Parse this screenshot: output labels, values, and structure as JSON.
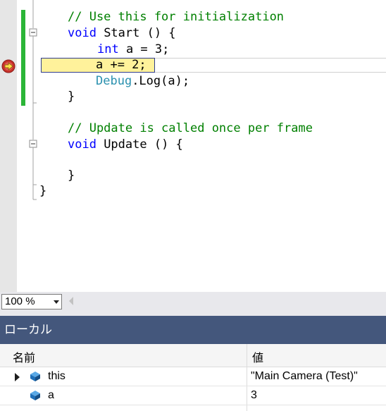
{
  "editor": {
    "lines": [
      {
        "id": "l1",
        "text": "// Use this for initialization"
      },
      {
        "id": "l2a",
        "text": "void"
      },
      {
        "id": "l2b",
        "text": " Start () {"
      },
      {
        "id": "l3a",
        "text": "int"
      },
      {
        "id": "l3b",
        "text": " a = 3;"
      },
      {
        "id": "l4",
        "text": "a += 2;"
      },
      {
        "id": "l5a",
        "text": "Debug"
      },
      {
        "id": "l5b",
        "text": ".Log(a);"
      },
      {
        "id": "l6",
        "text": "}"
      },
      {
        "id": "l7",
        "text": "// Update is called once per frame"
      },
      {
        "id": "l8a",
        "text": "void"
      },
      {
        "id": "l8b",
        "text": " Update () {"
      },
      {
        "id": "l9",
        "text": "}"
      },
      {
        "id": "l10",
        "text": "}"
      }
    ]
  },
  "zoom": {
    "value": "100 %"
  },
  "locals": {
    "title": "ローカル",
    "columns": {
      "name": "名前",
      "value": "値"
    },
    "rows": [
      {
        "name": "this",
        "value": "\"Main Camera (Test)\""
      },
      {
        "name": "a",
        "value": "3"
      }
    ]
  },
  "colors": {
    "comment": "#008000",
    "keyword": "#0000ff",
    "type": "#2b91af",
    "panel_title_bg": "#44577c",
    "highlight": "#fff29b",
    "change_bar": "#2bb537"
  }
}
